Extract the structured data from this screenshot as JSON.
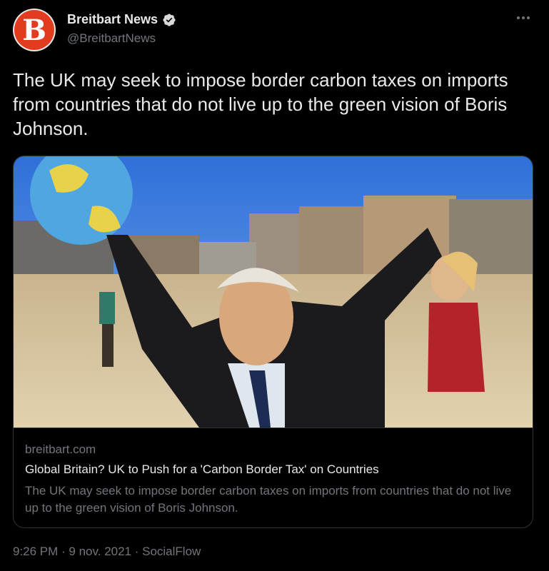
{
  "author": {
    "avatar_letter": "B",
    "display_name": "Breitbart News",
    "handle": "@BreitbartNews",
    "verified": true
  },
  "tweet": {
    "text": "The UK may seek to impose border carbon taxes on imports from countries that do not live up to the green vision of Boris Johnson."
  },
  "card": {
    "image_description": "Protesters wearing a Boris Johnson mask holding an inflatable globe on a beach",
    "domain": "breitbart.com",
    "title": "Global Britain? UK to Push for a 'Carbon Border Tax' on Countries",
    "description": "The UK may seek to impose border carbon taxes on imports from countries that do not live up to the green vision of Boris Johnson."
  },
  "meta": {
    "time": "9:26 PM",
    "date": "9 nov. 2021",
    "source": "SocialFlow",
    "line": "9:26 PM · 9 nov. 2021 · SocialFlow"
  },
  "colors": {
    "background": "#000000",
    "text": "#e7e9ea",
    "secondary": "#71767b",
    "verified": "#d9d9d9",
    "avatar_brand": "#e33b1f"
  },
  "icons": [
    "verified-badge-icon",
    "more-options-icon"
  ]
}
